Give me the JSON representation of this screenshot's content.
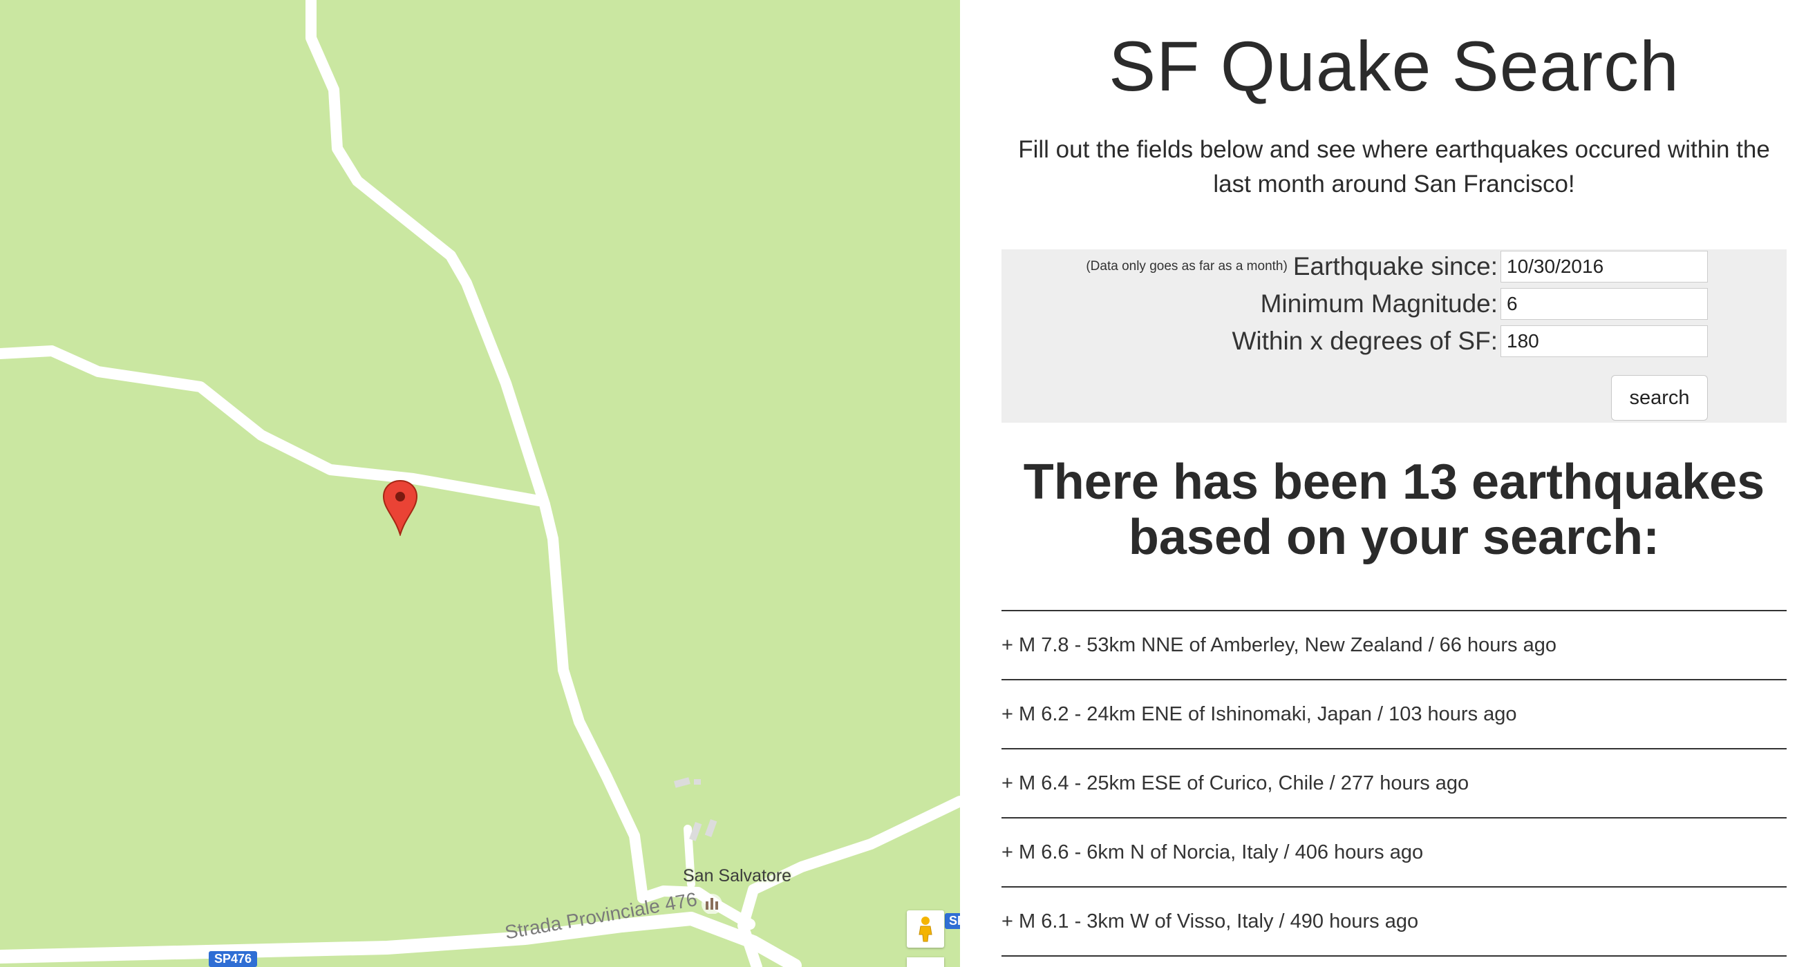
{
  "map": {
    "place_label": "San Salvatore",
    "road_label": "Strada Provinciale 476",
    "route_shield": "SP476",
    "route_shield_partial": "SP",
    "colors": {
      "land": "#cae7a1",
      "road": "#ffffff",
      "marker": "#ea4335"
    },
    "icons": [
      "map-marker-icon",
      "pegman-icon",
      "church-icon"
    ]
  },
  "page": {
    "title": "SF Quake Search",
    "intro": "Fill out the fields below and see where earthquakes occured within the last month around San Francisco!"
  },
  "form": {
    "since_note": "(Data only goes as far as a month)",
    "since_label": "Earthquake since:",
    "since_value": "10/30/2016",
    "magnitude_label": "Minimum Magnitude:",
    "magnitude_value": "6",
    "degrees_label": "Within x degrees of SF:",
    "degrees_value": "180",
    "search_label": "search"
  },
  "results": {
    "heading_line1": "There has been 13 earthquakes",
    "heading_line2": "based on your search:",
    "items": [
      "+ M 7.8 - 53km NNE of Amberley, New Zealand / 66 hours ago",
      "+ M 6.2 - 24km ENE of Ishinomaki, Japan / 103 hours ago",
      "+ M 6.4 - 25km ESE of Curico, Chile / 277 hours ago",
      "+ M 6.6 - 6km N of Norcia, Italy / 406 hours ago",
      "+ M 6.1 - 3km W of Visso, Italy / 490 hours ago"
    ]
  }
}
